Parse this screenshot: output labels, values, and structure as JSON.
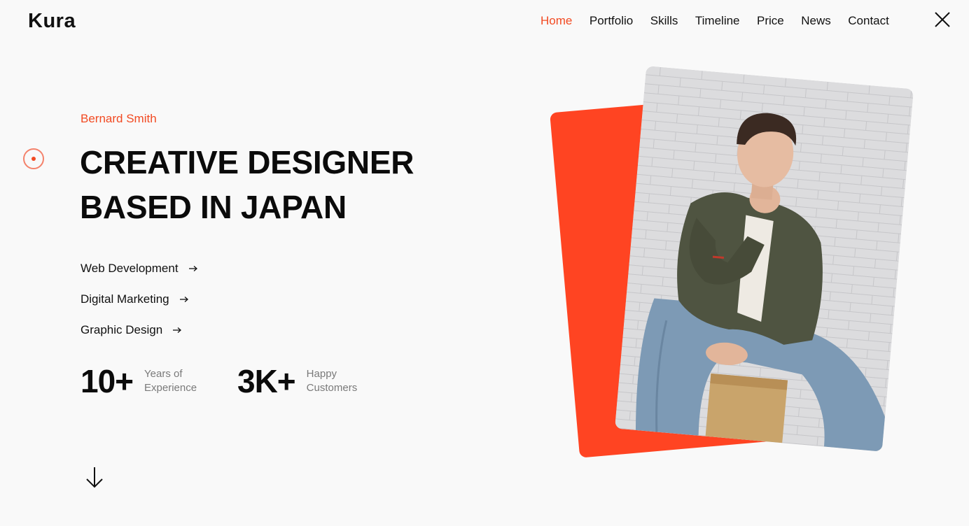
{
  "brand": {
    "logo_text": "Kura"
  },
  "nav": {
    "items": [
      {
        "label": "Home",
        "active": true
      },
      {
        "label": "Portfolio",
        "active": false
      },
      {
        "label": "Skills",
        "active": false
      },
      {
        "label": "Timeline",
        "active": false
      },
      {
        "label": "Price",
        "active": false
      },
      {
        "label": "News",
        "active": false
      },
      {
        "label": "Contact",
        "active": false
      }
    ],
    "close_icon": "close-icon"
  },
  "hero": {
    "name": "Bernard Smith",
    "headline_line1": "CREATIVE DESIGNER",
    "headline_line2": "BASED IN JAPAN",
    "services": [
      {
        "label": "Web Development",
        "icon": "arrow-right-icon"
      },
      {
        "label": "Digital Marketing",
        "icon": "arrow-right-icon"
      },
      {
        "label": "Graphic Design",
        "icon": "arrow-right-icon"
      }
    ],
    "stats": [
      {
        "number": "10+",
        "label_line1": "Years of",
        "label_line2": "Experience"
      },
      {
        "number": "3K+",
        "label_line1": "Happy",
        "label_line2": "Customers"
      }
    ],
    "scroll_icon": "arrow-down-icon"
  },
  "colors": {
    "accent": "#f24a22",
    "card": "#ff4422",
    "background": "#f9f9f9"
  }
}
